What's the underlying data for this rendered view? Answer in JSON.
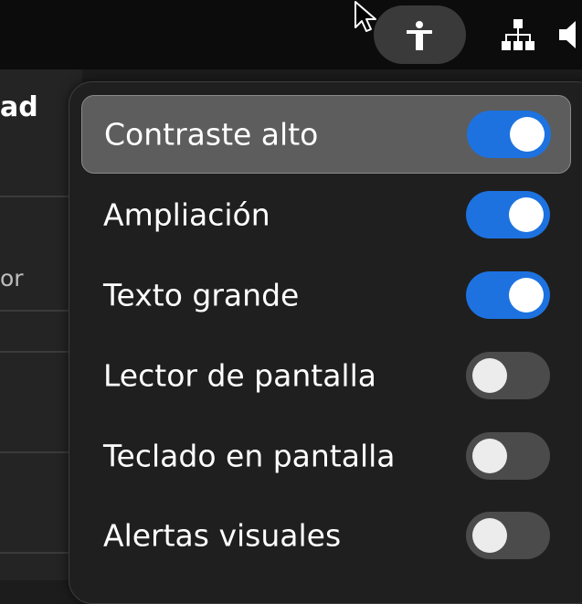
{
  "topbar": {
    "accessibility_icon": "accessibility-icon",
    "network_icon": "network-wired-icon",
    "volume_icon": "volume-icon"
  },
  "background_window": {
    "title_fragment": "ad",
    "row_fragment": "or"
  },
  "colors": {
    "toggle_on": "#1d72e0",
    "toggle_off": "#4b4b4b",
    "highlight": "#5d5d5d"
  },
  "menu": {
    "items": [
      {
        "label": "Contraste alto",
        "state": "on"
      },
      {
        "label": "Ampliación",
        "state": "on"
      },
      {
        "label": "Texto grande",
        "state": "on"
      },
      {
        "label": "Lector de pantalla",
        "state": "off"
      },
      {
        "label": "Teclado en pantalla",
        "state": "off"
      },
      {
        "label": "Alertas visuales",
        "state": "off"
      }
    ]
  }
}
